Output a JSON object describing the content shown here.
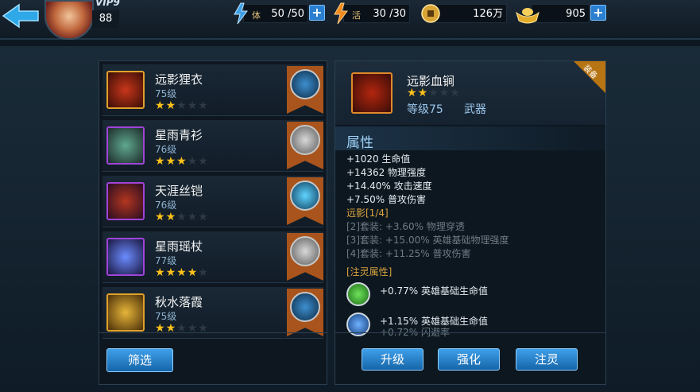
{
  "header": {
    "vip_label": "VIP9",
    "player_level": "88",
    "stamina": {
      "label": "体",
      "value": "50 /50"
    },
    "energy": {
      "label": "活",
      "value": "30 /30"
    },
    "gold": {
      "value": "126万"
    },
    "ingots": {
      "value": "905"
    },
    "plus_symbol": "+"
  },
  "equipment_list": [
    {
      "name": "远影狸衣",
      "level": "75级",
      "stars": 2,
      "max_stars": 5,
      "icon": "armor-icon",
      "hero": "hero-blue-helmet"
    },
    {
      "name": "星雨青衫",
      "level": "76级",
      "stars": 3,
      "max_stars": 5,
      "icon": "robe-icon",
      "hero": "hero-white-hair"
    },
    {
      "name": "天涯丝铠",
      "level": "76级",
      "stars": 2,
      "max_stars": 5,
      "icon": "silk-armor-icon",
      "hero": "hero-blue-spirit"
    },
    {
      "name": "星雨瑶杖",
      "level": "77级",
      "stars": 4,
      "max_stars": 5,
      "icon": "staff-icon",
      "hero": "hero-white-hair"
    },
    {
      "name": "秋水落霞",
      "level": "75级",
      "stars": 2,
      "max_stars": 5,
      "icon": "bracelet-icon",
      "hero": "hero-blue-helmet"
    }
  ],
  "filter_button": "筛选",
  "detail": {
    "name": "远影血锏",
    "stars": 2,
    "max_stars": 5,
    "level": "等级75",
    "type": "武器",
    "tag": "装备",
    "attributes_title": "属性",
    "stats": [
      "+1020 生命值",
      "+14362 物理强度",
      "+14.40% 攻击速度",
      "+7.50% 普攻伤害"
    ],
    "set_title": "远影[1/4]",
    "set_bonuses": [
      "[2]套装: +3.60% 物理穿透",
      "[3]套装: +15.00% 英雄基础物理强度",
      "[4]套装: +11.25% 普攻伤害"
    ],
    "spirit_title": "[注灵属性]",
    "spirits": [
      {
        "text": "+0.77% 英雄基础生命值",
        "color": "#37b52e"
      },
      {
        "text": "+1.15% 英雄基础生命值",
        "color": "#2f7fe0",
        "subtext": "+0.72% 闪避率"
      }
    ]
  },
  "actions": {
    "upgrade": "升级",
    "enhance": "强化",
    "infuse": "注灵"
  },
  "colors": {
    "accent": "#3fa0ea",
    "gold_star": "#ffc21a",
    "set_title": "#d9a43c"
  },
  "star_char": "★"
}
